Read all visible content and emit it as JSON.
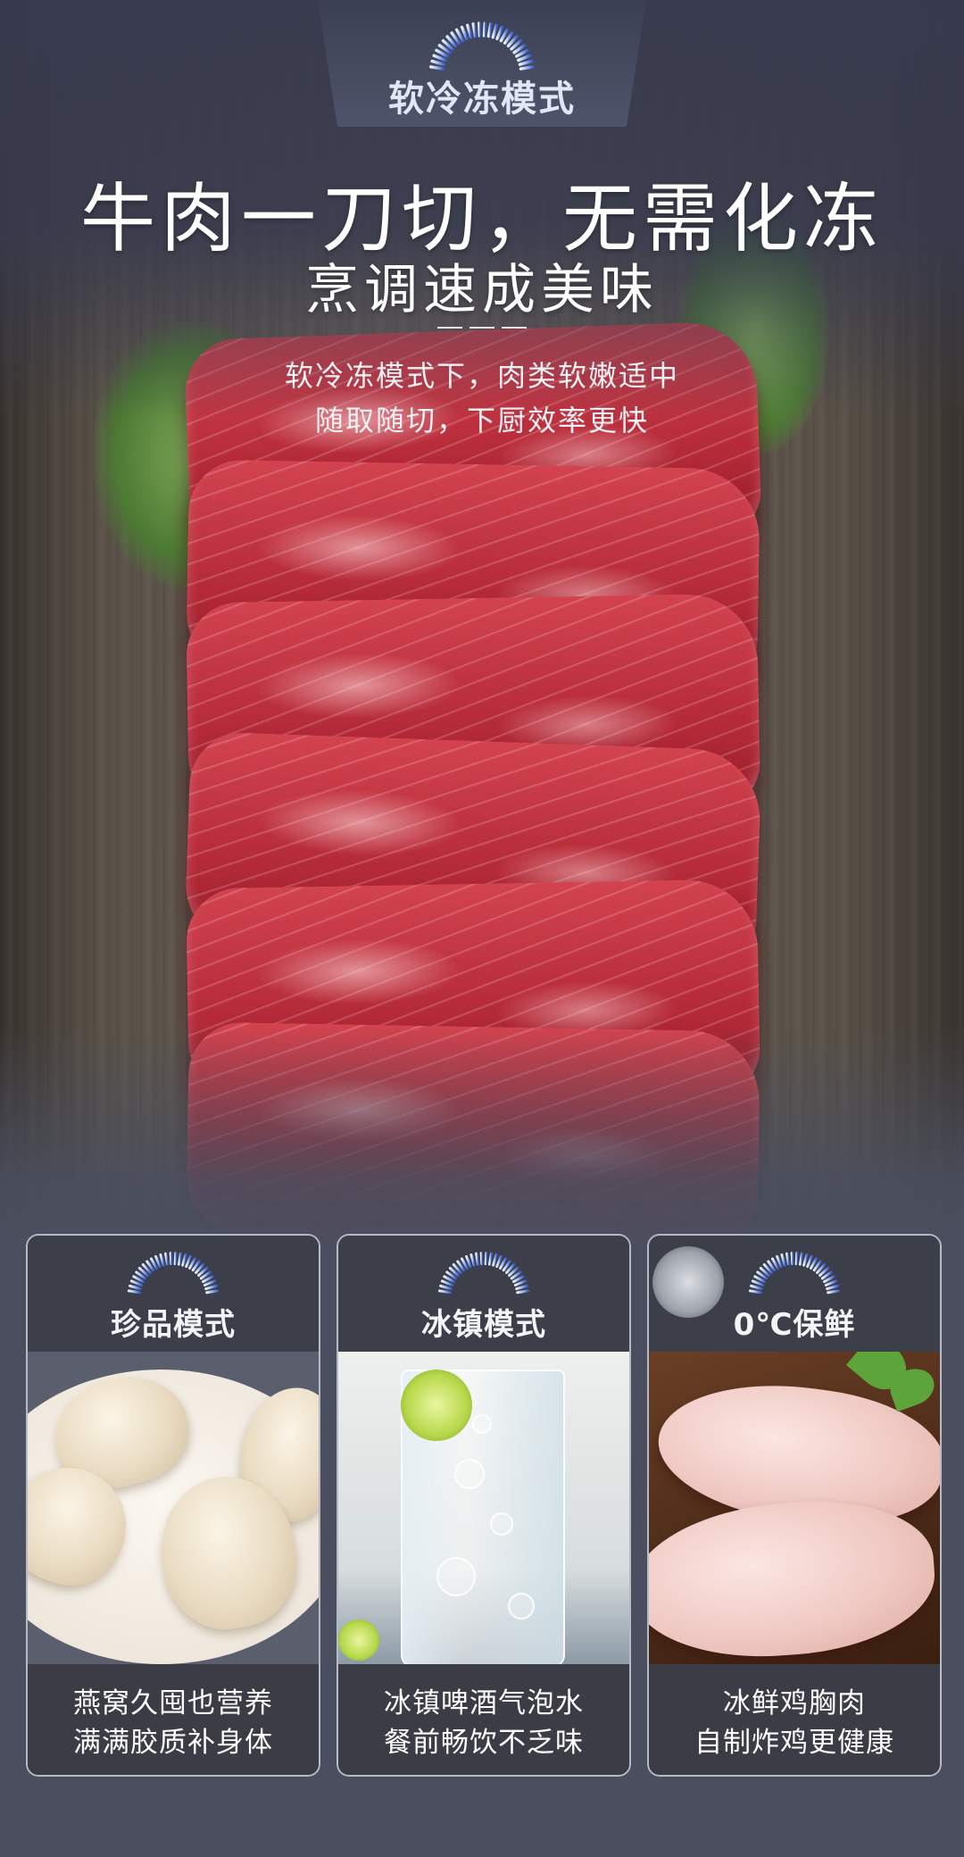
{
  "hero": {
    "mode_tab": {
      "title": "软冷冻模式"
    },
    "headline": "牛肉一刀切，无需化冻",
    "subheadline": "烹调速成美味",
    "description": [
      "软冷冻模式下，肉类软嫩适中",
      "随取随切，下厨效率更快"
    ]
  },
  "cards": [
    {
      "title": "珍品模式",
      "image": "bird-nest-image",
      "lines": [
        "燕窝久囤也营养",
        "满满胶质补身体"
      ]
    },
    {
      "title": "冰镇模式",
      "image": "iced-drink-image",
      "lines": [
        "冰镇啤酒气泡水",
        "餐前畅饮不乏味"
      ]
    },
    {
      "title": "0℃保鲜",
      "image": "chicken-breast-image",
      "lines": [
        "冰鲜鸡胸肉",
        "自制炸鸡更健康"
      ]
    }
  ],
  "colors": {
    "background": "#4a4e5e",
    "arc_gradient_start": "#4a6fd0",
    "arc_gradient_end": "#e8f0ff",
    "meat": "#c2303f"
  }
}
